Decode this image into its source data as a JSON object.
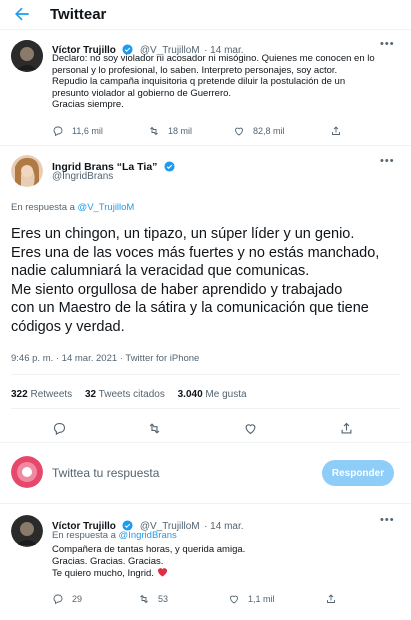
{
  "header": {
    "title": "Twittear"
  },
  "tweet1": {
    "name": "Víctor Trujillo",
    "handle": "@V_TrujilloM",
    "date": "· 14 mar.",
    "text": [
      "Declaro: no soy violador ni acosador ni misógino. Quienes me conocen en lo",
      "personal y lo profesional, lo saben. Interpreto personajes, soy actor.",
      "Repudio la campaña inquisitoria q pretende diluir la postulación de un",
      "presunto violador al gobierno de Guerrero.",
      "Gracias siempre."
    ],
    "replies": "11,6 mil",
    "retweets": "18 mil",
    "likes": "82,8 mil"
  },
  "main": {
    "name": "Ingrid Brans “La Tia”",
    "handle": "@IngridBrans",
    "reply_prefix": "En respuesta a ",
    "reply_to": "@V_TrujilloM",
    "text": [
      "Eres un chingon, un tipazo, un súper líder y un genio.",
      "Eres una de las voces más fuertes y no estás manchado,",
      "nadie calumniará la veracidad que comunicas.",
      "Me siento orgullosa de haber aprendido y trabajado",
      "con un Maestro de la sátira y la comunicación que tiene",
      "códigos y verdad."
    ],
    "timestamp": "9:46 p. m. · 14 mar. 2021 · Twitter for iPhone",
    "stats": {
      "retweets_count": "322",
      "retweets_label": "Retweets",
      "quotes_count": "32",
      "quotes_label": "Tweets citados",
      "likes_count": "3.040",
      "likes_label": "Me gusta"
    }
  },
  "compose": {
    "placeholder": "Twittea tu respuesta",
    "button": "Responder"
  },
  "tweet3": {
    "name": "Víctor Trujillo",
    "handle": "@V_TrujilloM",
    "date": "· 14 mar.",
    "reply_prefix": "En respuesta a ",
    "reply_to": "@IngridBrans",
    "text": [
      "Compañera de tantas horas, y querida amiga.",
      "Gracias. Gracias. Gracias.",
      "Te quiero mucho, Ingrid."
    ],
    "replies": "29",
    "retweets": "53",
    "likes": "1,1 mil"
  },
  "colors": {
    "accent": "#1d9bf0",
    "muted": "#536471",
    "heart": "#e0245e"
  },
  "icons": [
    "back-arrow-icon",
    "verified-icon",
    "reply-icon",
    "retweet-icon",
    "like-icon",
    "share-icon",
    "more-icon"
  ]
}
